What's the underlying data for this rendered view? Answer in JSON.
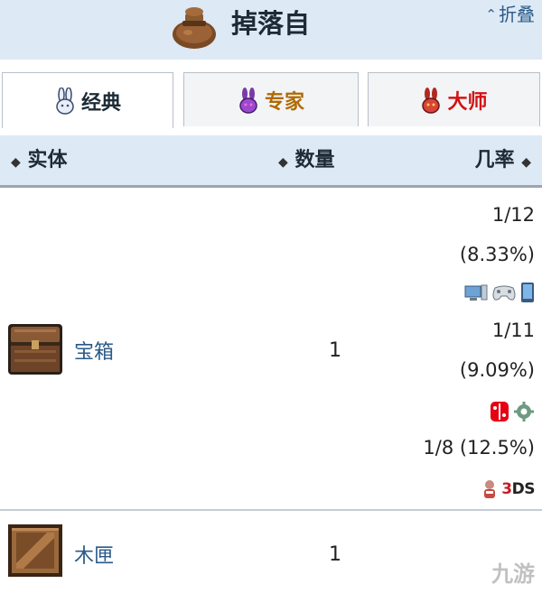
{
  "header": {
    "icon": "loot-bag-icon",
    "title": "掉落自",
    "collapse_label": "折叠",
    "background": "#dde9f5"
  },
  "tabs": [
    {
      "icon": "bunny-icon",
      "label": "经典",
      "active": true,
      "color": "#1d2b36"
    },
    {
      "icon": "purple-demon-icon",
      "label": "专家",
      "active": false,
      "color": "#b06a00"
    },
    {
      "icon": "red-demon-icon",
      "label": "大师",
      "active": false,
      "color": "#d41111"
    }
  ],
  "table": {
    "columns": [
      "实体",
      "数量",
      "几率"
    ],
    "rows": [
      {
        "icon": "chest-icon",
        "name": "宝箱",
        "quantity": "1",
        "rates": [
          {
            "fraction": "1/12",
            "percent": "(8.33%)",
            "platforms": [
              "pc-icon",
              "console-icon",
              "mobile-icon"
            ]
          },
          {
            "fraction": "1/11",
            "percent": "(9.09%)",
            "platforms": [
              "switch-icon",
              "gear-icon"
            ]
          },
          {
            "text": "1/8 (12.5%)",
            "platforms": [
              "3ds-icon"
            ],
            "platform_text": {
              "three": "3",
              "ds": "DS"
            }
          }
        ]
      },
      {
        "icon": "crate-icon",
        "name": "木匣",
        "quantity": "1"
      }
    ]
  },
  "watermark": "九游"
}
